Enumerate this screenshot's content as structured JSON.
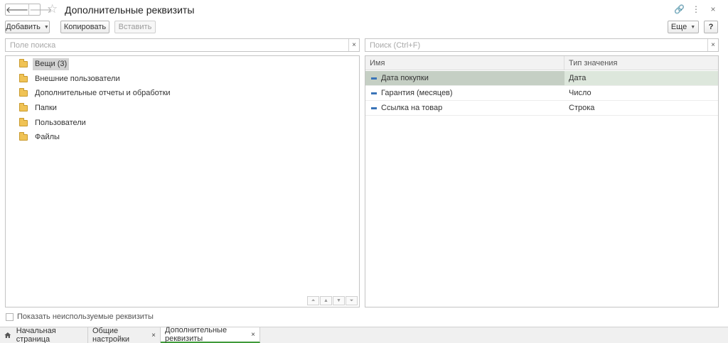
{
  "window": {
    "title": "Дополнительные реквизиты",
    "nav_back": "🡐",
    "nav_forward": "🡒",
    "star_icon": "☆",
    "link_icon": "🔗",
    "more_icon": "⋮",
    "close_icon": "×"
  },
  "toolbar": {
    "add_label": "Добавить",
    "add_caret": "▼",
    "copy_label": "Копировать",
    "paste_label": "Вставить",
    "more_label": "Еще",
    "more_caret": "▼",
    "help_label": "?"
  },
  "left_search": {
    "placeholder": "Поле поиска",
    "value": "",
    "clear": "×"
  },
  "right_search": {
    "placeholder": "Поиск (Ctrl+F)",
    "value": "",
    "clear": "×"
  },
  "tree": {
    "items": [
      {
        "label": "Вещи (3)",
        "selected": true
      },
      {
        "label": "Внешние пользователи"
      },
      {
        "label": "Дополнительные отчеты и обработки"
      },
      {
        "label": "Папки"
      },
      {
        "label": "Пользователи"
      },
      {
        "label": "Файлы"
      }
    ],
    "nav": {
      "first": "⏶",
      "up": "▲",
      "down": "▼",
      "last": "⏷"
    }
  },
  "table": {
    "columns": [
      "Имя",
      "Тип значения"
    ],
    "rows": [
      {
        "name": "Дата покупки",
        "type": "Дата",
        "selected": true
      },
      {
        "name": "Гарантия (месяцев)",
        "type": "Число"
      },
      {
        "name": "Ссылка на товар",
        "type": "Строка"
      }
    ]
  },
  "show_unused": {
    "label": "Показать неиспользуемые реквизиты",
    "checked": false
  },
  "tabs": [
    {
      "label": "Начальная страница",
      "icon": "home-icon"
    },
    {
      "label": "Общие настройки",
      "close": "×"
    },
    {
      "label": "Дополнительные реквизиты",
      "close": "×",
      "active": true
    }
  ],
  "colors": {
    "accent": "#3f9a3a",
    "row_selected": "#c5cfc4",
    "folder": "#f0c355",
    "property_icon": "#3a74b8"
  }
}
